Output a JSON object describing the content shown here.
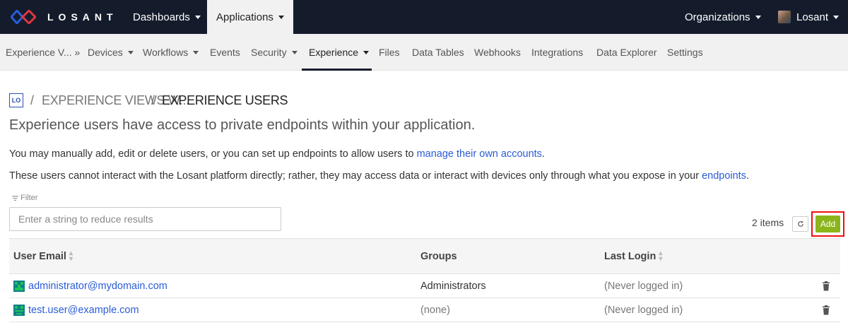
{
  "topnav": {
    "logo_text": "LOSANT",
    "dashboards": "Dashboards",
    "applications": "Applications",
    "organizations": "Organizations",
    "user": "Losant"
  },
  "subnav": {
    "items": [
      "Experience V... »",
      "Devices",
      "Workflows",
      "Events",
      "Security",
      "Experience",
      "Files",
      "Data Tables",
      "Webhooks",
      "Integrations",
      "Data Explorer",
      "Settings"
    ]
  },
  "breadcrumb": {
    "app_badge": "LO",
    "sep": "/",
    "parent": "EXPERIENCE VIEWS W...",
    "current": "EXPERIENCE USERS"
  },
  "page": {
    "subtitle": "Experience users have access to private endpoints within your application.",
    "para1_text": "You may manually add, edit or delete users, or you can set up endpoints to allow users to ",
    "para1_link": "manage their own accounts",
    "para1_end": ".",
    "para2_text": "These users cannot interact with the Losant platform directly; rather, they may access data or interact with devices only through what you expose in your ",
    "para2_link": "endpoints",
    "para2_end": "."
  },
  "filter": {
    "label": "Filter",
    "placeholder": "Enter a string to reduce results"
  },
  "toolbar": {
    "items_count": "2 items",
    "add_label": "Add"
  },
  "table": {
    "headers": {
      "email": "User Email",
      "groups": "Groups",
      "last_login": "Last Login"
    },
    "rows": [
      {
        "email": "administrator@mydomain.com",
        "groups": "Administrators",
        "last_login": "(Never logged in)"
      },
      {
        "email": "test.user@example.com",
        "groups": "(none)",
        "last_login": "(Never logged in)"
      }
    ]
  },
  "colors": {
    "topnav_bg": "#141c2c",
    "link": "#2a5bd7",
    "add_button": "#8cb51c",
    "highlight": "#ee1111"
  }
}
